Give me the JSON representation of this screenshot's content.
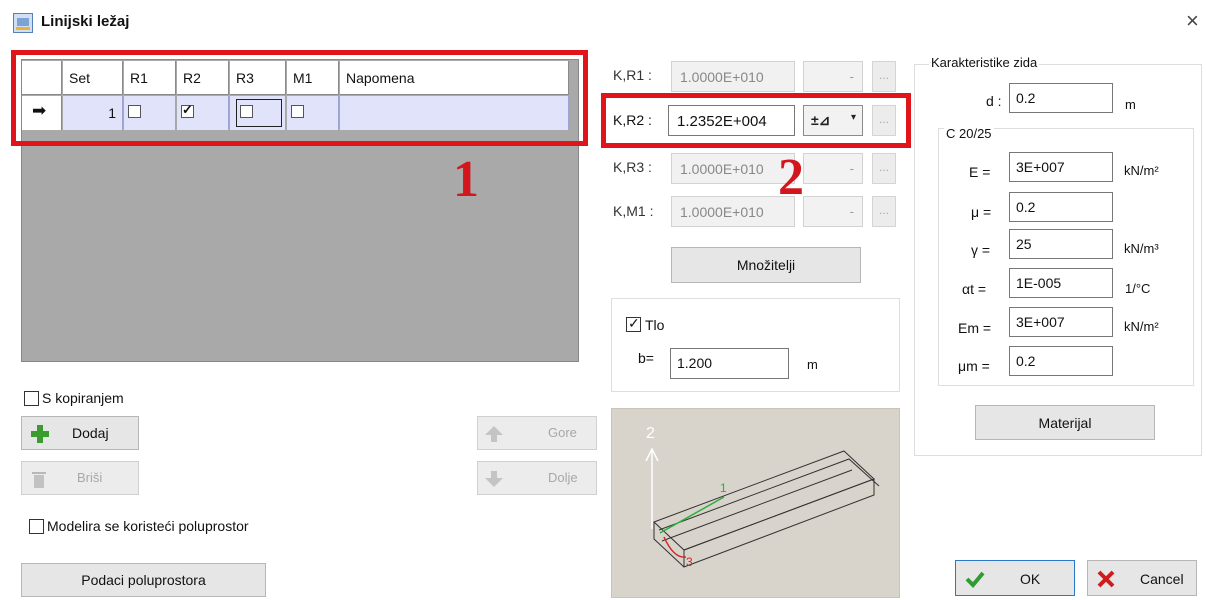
{
  "window": {
    "title": "Linijski ležaj",
    "close_glyph": "×"
  },
  "grid": {
    "columns": [
      "Set",
      "R1",
      "R2",
      "R3",
      "M1",
      "Napomena"
    ],
    "row_indicator": "➡",
    "rows": [
      {
        "set": "1",
        "r1": false,
        "r2": true,
        "r3": false,
        "m1": false,
        "napomena": ""
      }
    ]
  },
  "annotations": {
    "marker1": "1",
    "marker2": "2"
  },
  "left_controls": {
    "copy_checkbox_label": "S kopiranjem",
    "copy_checked": false,
    "add_label": "Dodaj",
    "delete_label": "Briši",
    "up_label": "Gore",
    "down_label": "Dolje",
    "halfspace_checkbox_label": "Modelira se koristeći poluprostor",
    "halfspace_checked": false,
    "halfspace_data_label": "Podaci poluprostora"
  },
  "stiffness": {
    "items": [
      {
        "label": "K,R1 :",
        "value": "1.0000E+010",
        "active": false,
        "icon": ""
      },
      {
        "label": "K,R2 :",
        "value": "1.2352E+004",
        "active": true,
        "icon": "±⊿"
      },
      {
        "label": "K,R3 :",
        "value": "1.0000E+010",
        "active": false,
        "icon": ""
      },
      {
        "label": "K,M1 :",
        "value": "1.0000E+010",
        "active": false,
        "icon": ""
      }
    ],
    "dots": "...",
    "multipliers_label": "Množitelji"
  },
  "soil": {
    "label": "Tlo",
    "checked": true,
    "b_label": "b=",
    "b_value": "1.200",
    "b_unit": "m"
  },
  "preview": {
    "axis_z": "2",
    "axis_y": "1",
    "axis_x": "3"
  },
  "wall": {
    "group_title": "Karakteristike zida",
    "d_label": "d :",
    "d_value": "0.2",
    "d_unit": "m",
    "material_group_title": "C 20/25",
    "props": [
      {
        "label": "E =",
        "value": "3E+007",
        "unit": "kN/m²"
      },
      {
        "label": "μ =",
        "value": "0.2",
        "unit": ""
      },
      {
        "label": "γ =",
        "value": "25",
        "unit": "kN/m³"
      },
      {
        "label": "αt =",
        "value": "1E-005",
        "unit": "1/°C"
      },
      {
        "label": "Em =",
        "value": "3E+007",
        "unit": "kN/m²"
      },
      {
        "label": "μm =",
        "value": "0.2",
        "unit": ""
      }
    ],
    "material_button_label": "Materijal"
  },
  "footer": {
    "ok_label": "OK",
    "cancel_label": "Cancel"
  },
  "colors": {
    "highlight": "#e0151c",
    "grid_row": "#e1e3fb",
    "grid_bg": "#a9a9a9",
    "add_icon": "#3a9b2e",
    "cancel_icon": "#d21b1b"
  }
}
